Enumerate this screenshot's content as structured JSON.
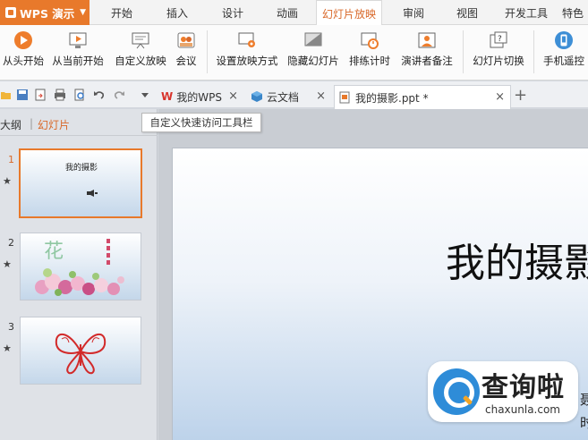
{
  "app": {
    "title": "WPS 演示",
    "accent": "#e8792b"
  },
  "menu_tabs": [
    "开始",
    "插入",
    "设计",
    "动画",
    "幻灯片放映",
    "审阅",
    "视图",
    "开发工具",
    "特色"
  ],
  "ribbon": {
    "buttons": [
      {
        "label": "从头开始",
        "icon": "play-circle-icon"
      },
      {
        "label": "从当前开始",
        "icon": "play-from-current-icon"
      },
      {
        "label": "自定义放映",
        "icon": "custom-show-icon"
      },
      {
        "label": "会议",
        "icon": "meeting-icon"
      },
      {
        "label": "设置放映方式",
        "icon": "slideshow-settings-icon"
      },
      {
        "label": "隐藏幻灯片",
        "icon": "hide-slide-icon"
      },
      {
        "label": "排练计时",
        "icon": "rehearse-timing-icon"
      },
      {
        "label": "演讲者备注",
        "icon": "speaker-notes-icon"
      },
      {
        "label": "幻灯片切换",
        "icon": "slide-transition-icon"
      },
      {
        "label": "手机遥控",
        "icon": "phone-remote-icon"
      }
    ]
  },
  "doc_tabs": [
    {
      "label": "我的WPS",
      "icon": "wps-logo-icon"
    },
    {
      "label": "云文档",
      "icon": "cloud-doc-icon"
    },
    {
      "label": "我的摄影.ppt *",
      "icon": "ppt-file-icon"
    }
  ],
  "tooltip": "自定义快速访问工具栏",
  "left_panel": {
    "tab_outline": "大纲",
    "tab_divider": "|",
    "tab_slides": "幻灯片",
    "slides": [
      {
        "number": "1",
        "title": "我的摄影",
        "star": "★"
      },
      {
        "number": "2",
        "title": "花",
        "star": "★"
      },
      {
        "number": "3",
        "title": "",
        "star": "★"
      }
    ]
  },
  "slide": {
    "title": "我的摄影",
    "fragment1": "聂",
    "fragment2": "时"
  },
  "watermark": {
    "title": "查询啦",
    "url": "chaxunla.com"
  }
}
